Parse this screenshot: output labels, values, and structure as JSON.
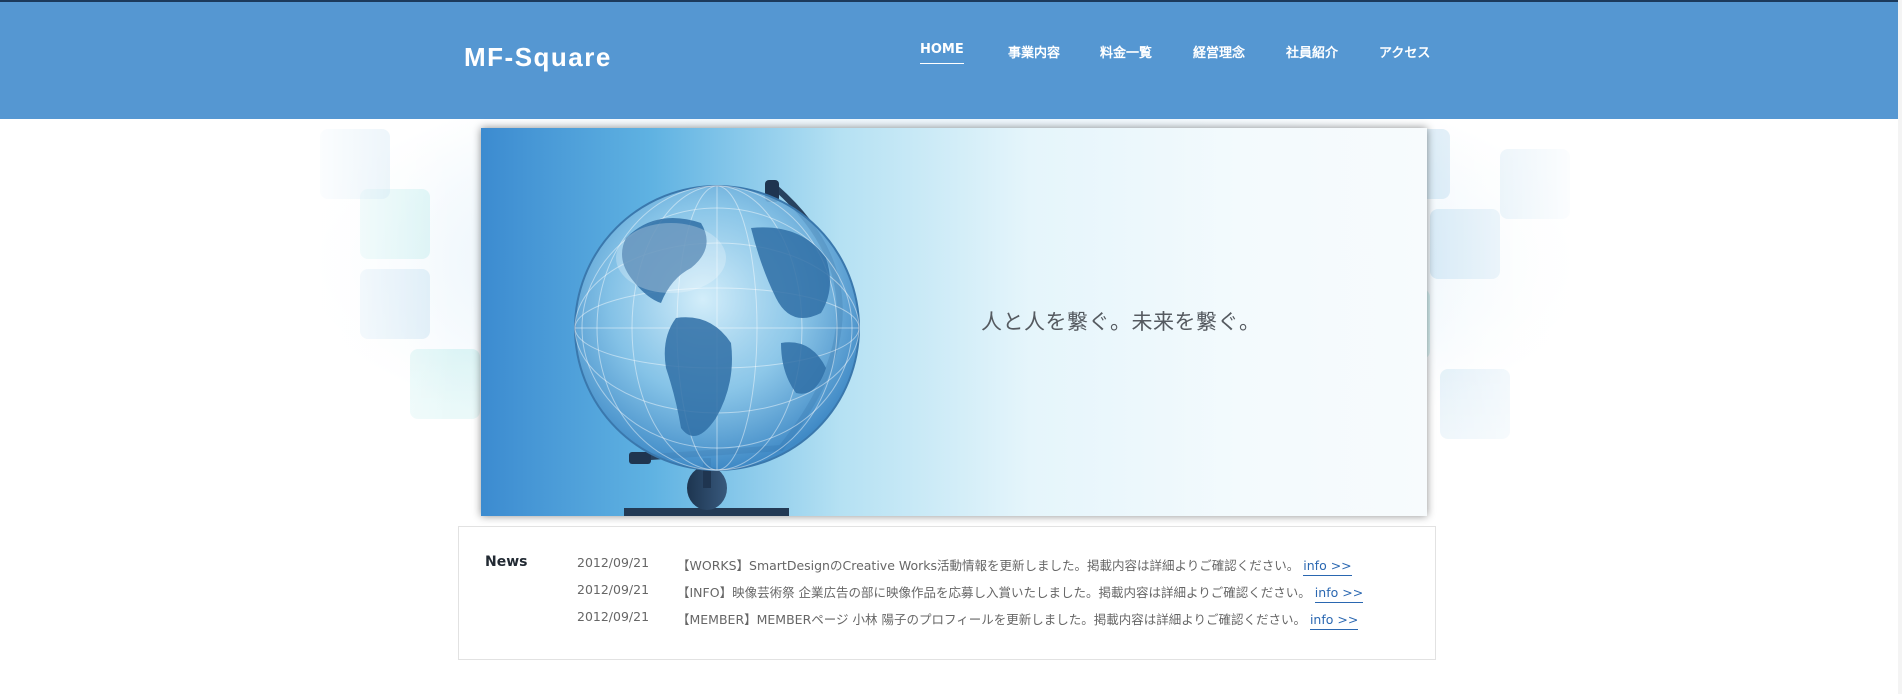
{
  "header": {
    "logo": "MF-Square",
    "nav": [
      {
        "label": "HOME",
        "active": true
      },
      {
        "label": "事業内容",
        "active": false
      },
      {
        "label": "料金一覧",
        "active": false
      },
      {
        "label": "経営理念",
        "active": false
      },
      {
        "label": "社員紹介",
        "active": false
      },
      {
        "label": "アクセス",
        "active": false
      }
    ]
  },
  "hero": {
    "tagline": "人と人を繋ぐ。未来を繋ぐ。",
    "image": "globe-image"
  },
  "news": {
    "title": "News",
    "items": [
      {
        "date": "2012/09/21",
        "text": "【WORKS】SmartDesignのCreative Works活動情報を更新しました。掲載内容は詳細よりご確認ください。",
        "link": "info >>"
      },
      {
        "date": "2012/09/21",
        "text": "【INFO】映像芸術祭 企業広告の部に映像作品を応募し入賞いたしました。掲載内容は詳細よりご確認ください。",
        "link": "info >>"
      },
      {
        "date": "2012/09/21",
        "text": "【MEMBER】MEMBERページ 小林 陽子のプロフィールを更新しました。掲載内容は詳細よりご確認ください。",
        "link": "info >>"
      }
    ]
  },
  "colors": {
    "header_bg": "#5597d2",
    "link": "#2a67b1",
    "text": "#666666"
  }
}
